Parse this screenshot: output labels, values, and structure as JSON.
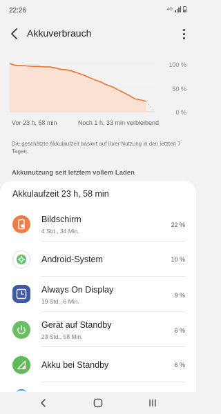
{
  "status": {
    "time": "22:26",
    "network": "4G",
    "icons": [
      "signal-icon",
      "battery-icon"
    ]
  },
  "appbar": {
    "title": "Akkuverbrauch",
    "back_icon": "back-arrow-icon",
    "more_icon": "more-options-icon"
  },
  "chart_data": {
    "type": "line",
    "series": [
      {
        "x": [
          0,
          1,
          2,
          3,
          4,
          5,
          6,
          7,
          8,
          9,
          10,
          11,
          12,
          13,
          14,
          15,
          16,
          17,
          18,
          19,
          20,
          21,
          22,
          23.97
        ],
        "values": [
          100,
          96,
          96,
          95,
          94,
          94,
          93,
          93,
          91,
          88,
          87,
          84,
          80,
          76,
          71,
          66,
          62,
          56,
          52,
          46,
          40,
          34,
          27,
          22
        ]
      }
    ],
    "projection": {
      "x": [
        23.97,
        25.5
      ],
      "values": [
        22,
        0
      ]
    },
    "yticks": [
      "100 %",
      "50 %",
      "0 %"
    ],
    "ylim": [
      0,
      100
    ],
    "left_label": "Vor 23 h, 58 min",
    "right_label": "Noch 1 h, 33 min verbleibend",
    "colors": {
      "line": "#f07030",
      "fill": "#fbe1d4",
      "dashes": "#c9c9c9"
    }
  },
  "note": "Die geschätzte Akkulaufzeit basiert auf Ihrer Nutzung in den letzten 7 Tagen.",
  "section_title": "Akkunutzung seit letztem vollem Laden",
  "card": {
    "header": "Akkulaufzeit 23 h, 58 min",
    "items": [
      {
        "name": "Bildschirm",
        "detail": "4 Std., 34 Min.",
        "value": "22 %",
        "icon": "screen-icon",
        "color": "#f07d48"
      },
      {
        "name": "Android-System",
        "detail": "",
        "value": "10 %",
        "icon": "android-settings-icon",
        "color": "#5cc46a"
      },
      {
        "name": "Always On Display",
        "detail": "19 Std., 6 Min.",
        "value": "9 %",
        "icon": "clock-icon",
        "color": "#3e5aa8"
      },
      {
        "name": "Gerät auf Standby",
        "detail": "23 Std., 58 Min.",
        "value": "6 %",
        "icon": "power-icon",
        "color": "#6bbd63"
      },
      {
        "name": "Akku bei Standby",
        "detail": "",
        "value": "6 %",
        "icon": "signal-strength-icon",
        "color": "#5fba5a"
      }
    ]
  },
  "navbar": {
    "icons": [
      "nav-back-icon",
      "nav-home-icon",
      "nav-recents-icon"
    ]
  }
}
